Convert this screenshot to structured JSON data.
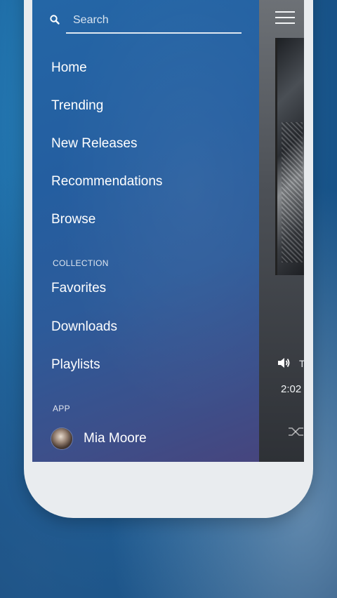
{
  "search": {
    "placeholder": "Search"
  },
  "nav": {
    "items": [
      {
        "label": "Home"
      },
      {
        "label": "Trending"
      },
      {
        "label": "New Releases"
      },
      {
        "label": "Recommendations"
      },
      {
        "label": "Browse"
      }
    ],
    "collection_label": "COLLECTION",
    "collection_items": [
      {
        "label": "Favorites"
      },
      {
        "label": "Downloads"
      },
      {
        "label": "Playlists"
      }
    ],
    "app_label": "APP"
  },
  "user": {
    "name": "Mia Moore"
  },
  "player": {
    "track_initial": "T",
    "time": "2:02"
  },
  "icons": {
    "search": "search-icon",
    "menu": "hamburger-menu-icon",
    "volume": "volume-icon",
    "shuffle": "shuffle-icon"
  },
  "colors": {
    "drawer_top": "#2466a6",
    "drawer_bottom": "#46457e",
    "text": "#ffffff"
  }
}
